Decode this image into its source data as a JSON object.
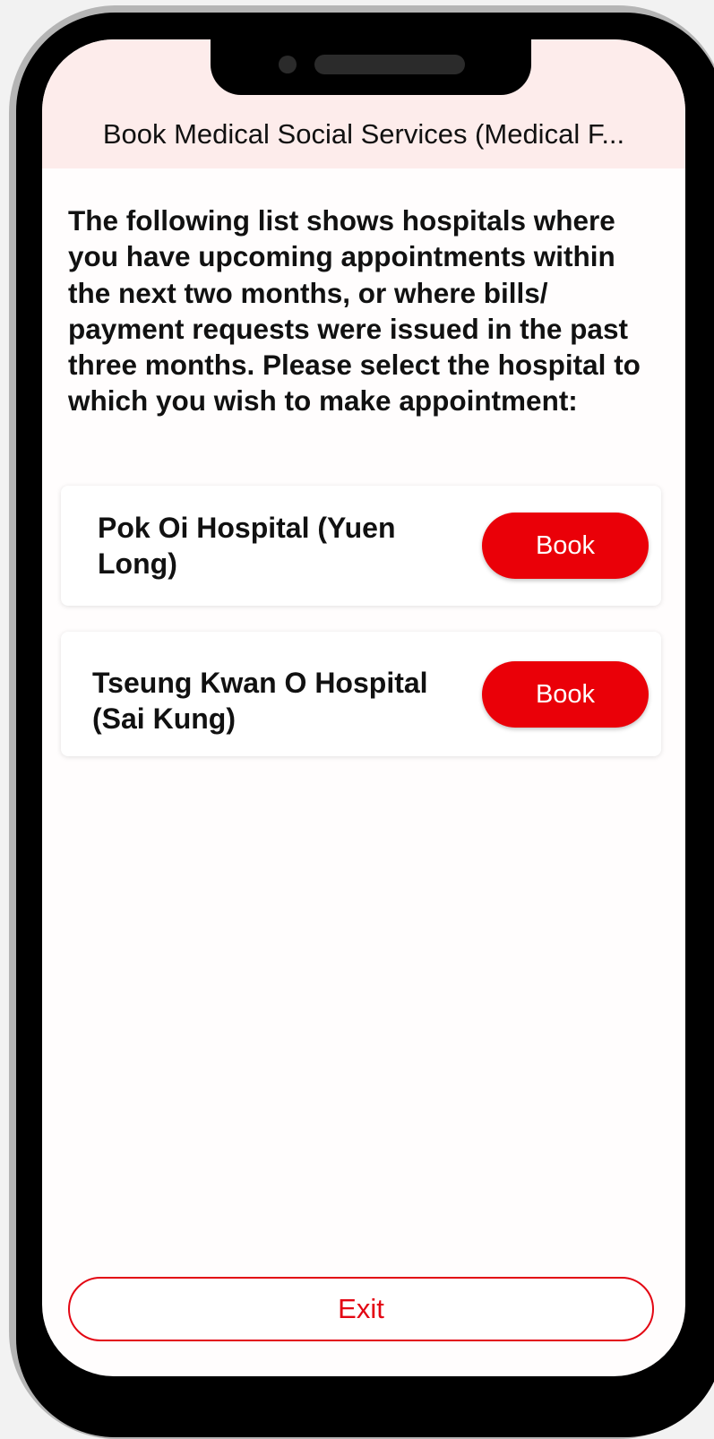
{
  "header": {
    "title": "Book Medical Social Services (Medical F..."
  },
  "instructions": "The following list shows hospitals where you have upcoming appointments within the next two months, or where bills/ payment requests were issued in the past three months. Please select the hospital to which you wish to make appointment:",
  "hospitals": [
    {
      "name": "Pok Oi Hospital (Yuen Long)",
      "button_label": "Book"
    },
    {
      "name": "Tseung Kwan O Hospital (Sai Kung)",
      "button_label": "Book"
    }
  ],
  "footer": {
    "exit_label": "Exit"
  },
  "colors": {
    "accent": "#e30613",
    "header_background": "#fdeceb"
  }
}
